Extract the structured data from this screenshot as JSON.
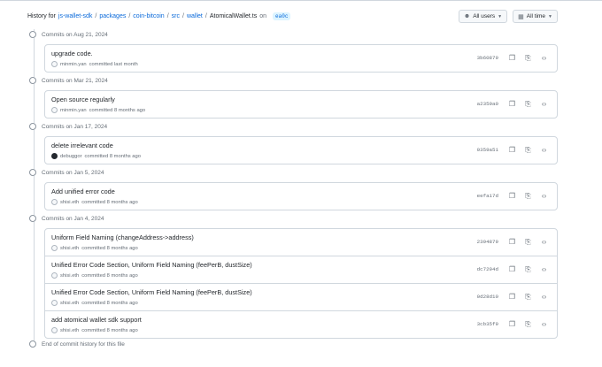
{
  "header": {
    "prefix": "History for",
    "path": [
      "js-wallet-sdk",
      "packages",
      "coin-bitcoin",
      "src",
      "wallet"
    ],
    "separator": "/",
    "file": "AtomicalWallet.ts",
    "on": "on",
    "branch": "ea0c"
  },
  "filters": {
    "users_label": "All users",
    "time_label": "All time"
  },
  "groups": [
    {
      "label": "Commits on Aug 21, 2024",
      "commits": [
        {
          "message": "upgrade code.",
          "author": "minmin.yan",
          "when": "committed last month",
          "sha": "3b60879",
          "avatar": "light"
        }
      ]
    },
    {
      "label": "Commits on Mar 21, 2024",
      "commits": [
        {
          "message": "Open source regularly",
          "author": "minmin.yan",
          "when": "committed 8 months ago",
          "sha": "a2359a0",
          "avatar": "light"
        }
      ]
    },
    {
      "label": "Commits on Jan 17, 2024",
      "commits": [
        {
          "message": "delete irrelevant code",
          "author": "debuggor",
          "when": "committed 8 months ago",
          "sha": "0359a51",
          "avatar": "dark"
        }
      ]
    },
    {
      "label": "Commits on Jan 5, 2024",
      "commits": [
        {
          "message": "Add unified error code",
          "author": "shisi.eth",
          "when": "committed 8 months ago",
          "sha": "eefa17d",
          "avatar": "light"
        }
      ]
    },
    {
      "label": "Commits on Jan 4, 2024",
      "commits": [
        {
          "message": "Uniform Field Naming (changeAddress->address)",
          "author": "shisi.eth",
          "when": "committed 8 months ago",
          "sha": "2394879",
          "avatar": "light"
        },
        {
          "message": "Unified Error Code Section, Uniform Field Naming (feePerB, dustSize)",
          "author": "shisi.eth",
          "when": "committed 8 months ago",
          "sha": "dc7294d",
          "avatar": "light"
        },
        {
          "message": "Unified Error Code Section, Uniform Field Naming (feePerB, dustSize)",
          "author": "shisi.eth",
          "when": "committed 8 months ago",
          "sha": "0d28d10",
          "avatar": "light"
        },
        {
          "message": "add atomical wallet sdk support",
          "author": "shisi.eth",
          "when": "committed 8 months ago",
          "sha": "3cb35f9",
          "avatar": "light"
        }
      ]
    }
  ],
  "end_label": "End of commit history for this file",
  "icons": {
    "people": "people-icon",
    "calendar": "calendar-icon",
    "caret": "caret-down-icon",
    "commit": "git-commit-icon",
    "copy": "copy-icon",
    "browse": "file-code-icon",
    "code": "code-icon"
  }
}
